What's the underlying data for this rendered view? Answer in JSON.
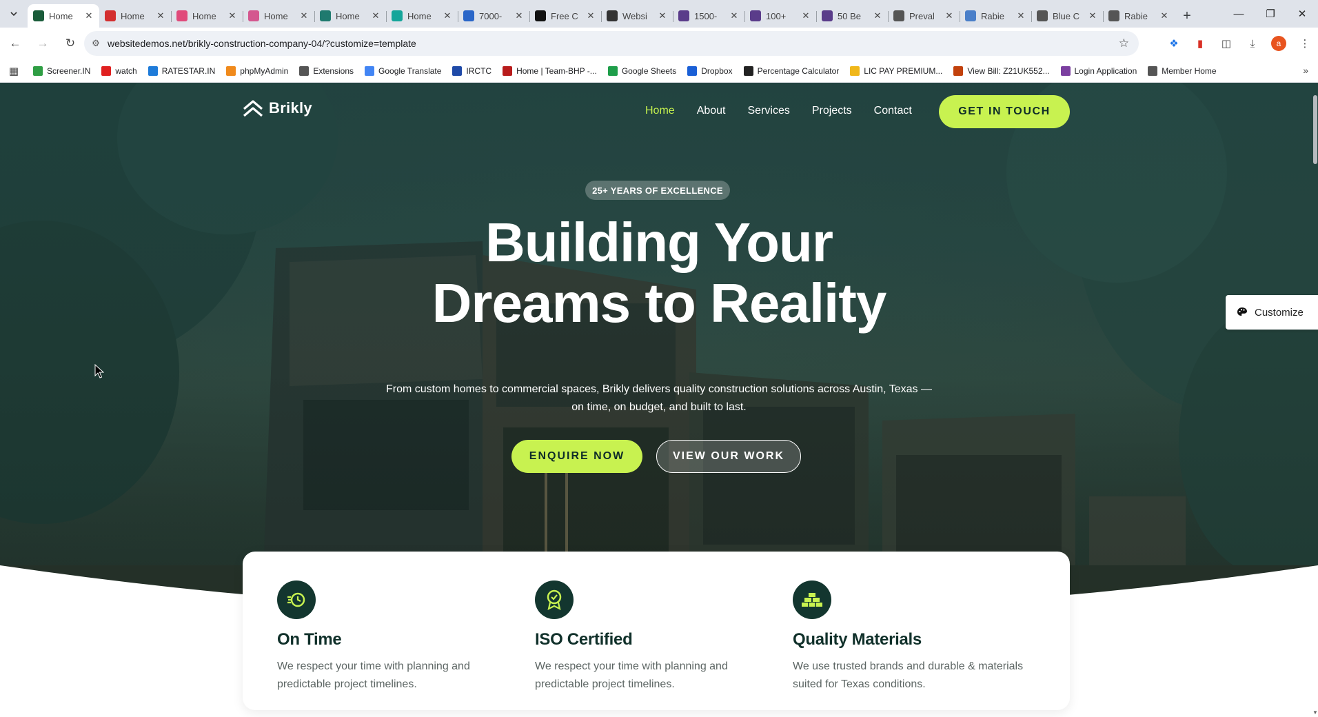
{
  "browser": {
    "tabs": [
      {
        "label": "Home",
        "favicon": "brikly-logo-icon",
        "color": "#1a5c3a",
        "active": true
      },
      {
        "label": "Home",
        "favicon": "red-swirl-icon",
        "color": "#d32f2f"
      },
      {
        "label": "Home",
        "favicon": "pink-wave-icon",
        "color": "#e04a7a"
      },
      {
        "label": "Home",
        "favicon": "pink-arrow-icon",
        "color": "#d4578f"
      },
      {
        "label": "Home",
        "favicon": "teal-leaf-icon",
        "color": "#1f7a6f"
      },
      {
        "label": "Home",
        "favicon": "teal-grid-icon",
        "color": "#14a59a"
      },
      {
        "label": "7000-",
        "favicon": "blue-w-icon",
        "color": "#2a66c8"
      },
      {
        "label": "Free C",
        "favicon": "framer-icon",
        "color": "#111111"
      },
      {
        "label": "Websi",
        "favicon": "wix-icon",
        "color": "#333333"
      },
      {
        "label": "1500-",
        "favicon": "purple-square-icon",
        "color": "#5a3c8a"
      },
      {
        "label": "100+",
        "favicon": "purple-square-icon",
        "color": "#5a3c8a"
      },
      {
        "label": "50 Be",
        "favicon": "purple-square-icon",
        "color": "#5a3c8a"
      },
      {
        "label": "Preval",
        "favicon": "wikipedia-icon",
        "color": "#555555"
      },
      {
        "label": "Rabie",
        "favicon": "globe-icon",
        "color": "#4a7fc9"
      },
      {
        "label": "Blue C",
        "favicon": "wikipedia-icon",
        "color": "#555555"
      },
      {
        "label": "Rabie",
        "favicon": "globe-icon",
        "color": "#555555"
      }
    ],
    "url": "websitedemos.net/brikly-construction-company-04/?customize=template",
    "avatar_letter": "a",
    "bookmarks": [
      {
        "label": "Screener.IN",
        "icon": "bar-chart-icon",
        "color": "#2f9e44"
      },
      {
        "label": "watch",
        "icon": "youtube-icon",
        "color": "#e02020"
      },
      {
        "label": "RATESTAR.IN",
        "icon": "star-icon",
        "color": "#1e7bd9"
      },
      {
        "label": "phpMyAdmin",
        "icon": "phpmyadmin-icon",
        "color": "#f08a1c"
      },
      {
        "label": "Extensions",
        "icon": "puzzle-icon",
        "color": "#555555"
      },
      {
        "label": "Google Translate",
        "icon": "translate-icon",
        "color": "#4285f4"
      },
      {
        "label": "IRCTC",
        "icon": "irctc-icon",
        "color": "#1f4aa8"
      },
      {
        "label": "Home | Team-BHP -...",
        "icon": "teambhp-icon",
        "color": "#b81c1c"
      },
      {
        "label": "Google Sheets",
        "icon": "sheets-icon",
        "color": "#1e9e4a"
      },
      {
        "label": "Dropbox",
        "icon": "dropbox-icon",
        "color": "#1a5fd6"
      },
      {
        "label": "Percentage Calculator",
        "icon": "percent-icon",
        "color": "#222222"
      },
      {
        "label": "LIC PAY PREMIUM...",
        "icon": "lic-icon",
        "color": "#f0b71a"
      },
      {
        "label": "View Bill: Z21UK552...",
        "icon": "bill-icon",
        "color": "#c2410c"
      },
      {
        "label": "Login Application",
        "icon": "login-icon",
        "color": "#7b3fa0"
      },
      {
        "label": "Member Home",
        "icon": "globe-icon",
        "color": "#555555"
      }
    ]
  },
  "site": {
    "logo_text": "Brikly",
    "nav": [
      "Home",
      "About",
      "Services",
      "Projects",
      "Contact"
    ],
    "nav_cta": "GET IN TOUCH",
    "badge": "25+ YEARS OF EXCELLENCE",
    "headline_line1": "Building Your",
    "headline_line2": "Dreams to Reality",
    "subtext": "From custom homes to commercial spaces, Brikly delivers quality construction solutions across Austin, Texas — on time, on budget, and built to last.",
    "btn_primary": "ENQUIRE NOW",
    "btn_secondary": "VIEW OUR WORK",
    "customize_label": "Customize",
    "accent_color": "#c8f250",
    "dark_color": "#13362f",
    "features": [
      {
        "icon": "fast-clock-icon",
        "title": "On Time",
        "text": "We respect your time with planning and predictable project timelines."
      },
      {
        "icon": "award-badge-icon",
        "title": "ISO Certified",
        "text": "We respect your time with planning and predictable project timelines."
      },
      {
        "icon": "bricks-icon",
        "title": "Quality Materials",
        "text": "We use trusted brands and durable & materials suited for Texas conditions."
      }
    ]
  }
}
